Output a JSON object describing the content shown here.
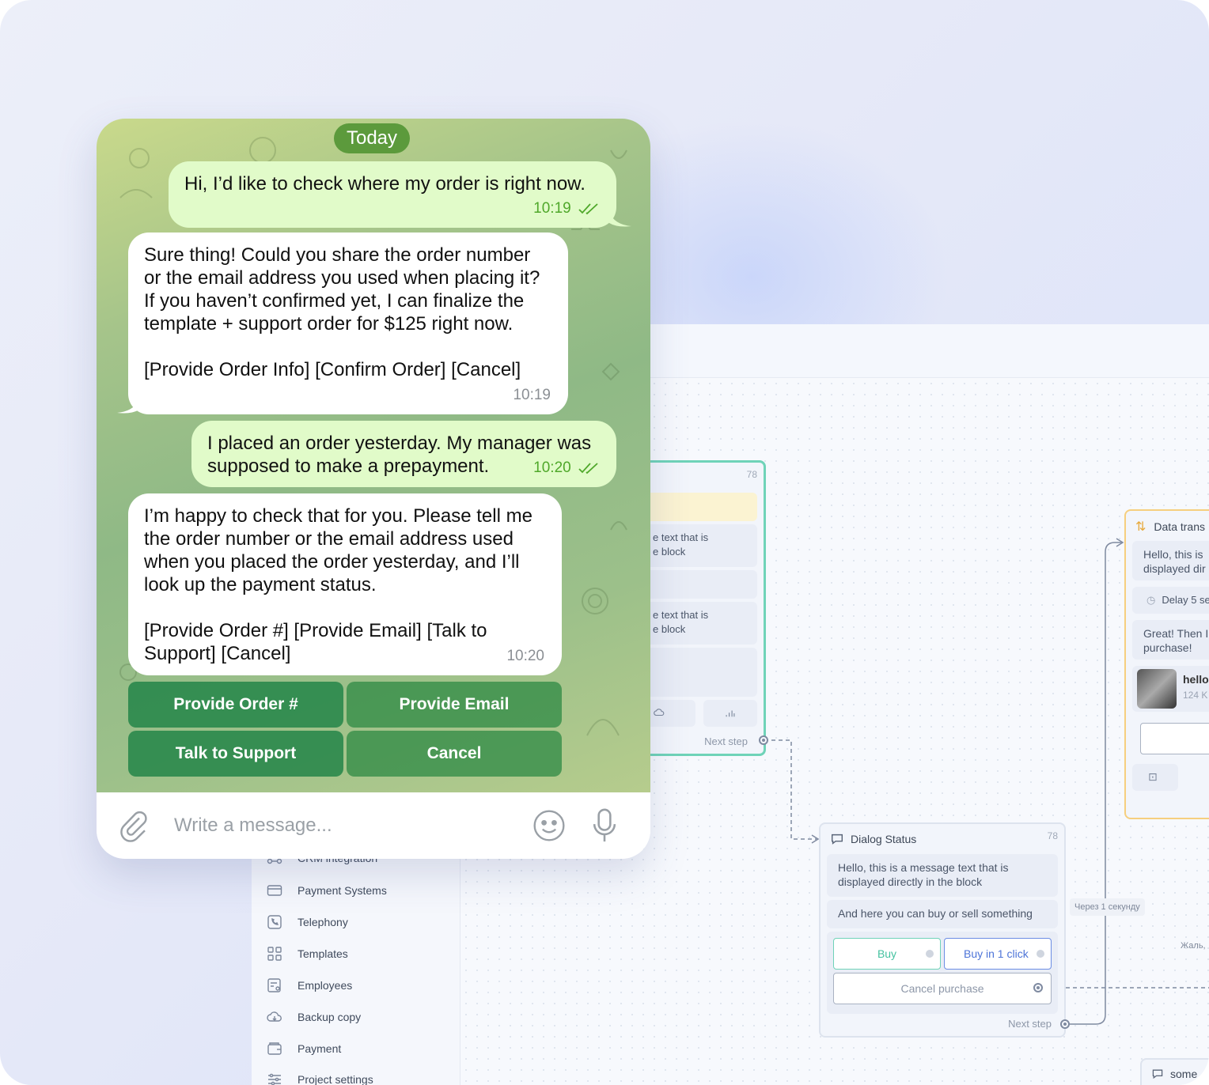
{
  "chat": {
    "date_label": "Today",
    "composer_placeholder": "Write a message...",
    "messages": [
      {
        "dir": "out",
        "text": "Hi, I’d like to check where my order is right now.",
        "time": "10:19"
      },
      {
        "dir": "in",
        "lines": [
          "Sure thing! Could you share the order number",
          "or the email address you used when placing it?",
          "If you haven’t confirmed yet, I can finalize the",
          "template + support order for $125 right now.",
          "",
          "[Provide Order Info] [Confirm Order] [Cancel]"
        ],
        "time": "10:19"
      },
      {
        "dir": "out",
        "lines": [
          "I placed an order yesterday. My manager was",
          "supposed to make a prepayment."
        ],
        "time": "10:20"
      },
      {
        "dir": "in",
        "lines": [
          "I’m happy to check that for you. Please tell me",
          "the order number or the email address used",
          "when you placed the order yesterday, and I’ll",
          "look up the payment status.",
          "",
          "[Provide Order #] [Provide Email] [Talk to",
          "Support] [Cancel]"
        ],
        "time": "10:20"
      }
    ],
    "keyboard": [
      "Provide Order #",
      "Provide Email",
      "Talk to Support",
      "Cancel"
    ]
  },
  "sidebar": {
    "items": [
      {
        "label": "CRM integration",
        "icon": "crm-icon"
      },
      {
        "label": "Payment Systems",
        "icon": "card-icon"
      },
      {
        "label": "Telephony",
        "icon": "phone-icon"
      },
      {
        "label": "Templates",
        "icon": "grid-icon"
      },
      {
        "label": "Employees",
        "icon": "employee-icon"
      },
      {
        "label": "Backup copy",
        "icon": "cloud-icon"
      },
      {
        "label": "Payment",
        "icon": "wallet-icon"
      },
      {
        "label": "Project settings",
        "icon": "sliders-icon"
      }
    ]
  },
  "flow": {
    "block_left": {
      "number": "78",
      "row1": "e text that is",
      "row1b": "e block",
      "row2": "e text that is",
      "row2b": "e block",
      "next_step": "Next step"
    },
    "dialog_status": {
      "title": "Dialog Status",
      "number": "78",
      "message_line1": "Hello, this is a message text that is",
      "message_line2": "displayed directly in the block",
      "buy_sell": "And here you can buy or sell something",
      "buy": "Buy",
      "buy_one_click": "Buy in 1 click",
      "cancel_purchase": "Cancel purchase",
      "next_step": "Next step"
    },
    "data_transfer": {
      "title": "Data trans",
      "msg1a": "Hello, this is",
      "msg1b": "displayed dir",
      "delay": "Delay 5 se",
      "msg2a": "Great! Then I",
      "msg2b": "purchase!",
      "file_name": "hello",
      "file_size": "124 K"
    },
    "edge_label_1": "Через 1 секунду",
    "edge_label_2": "Жаль,",
    "bottom_block": "some"
  }
}
